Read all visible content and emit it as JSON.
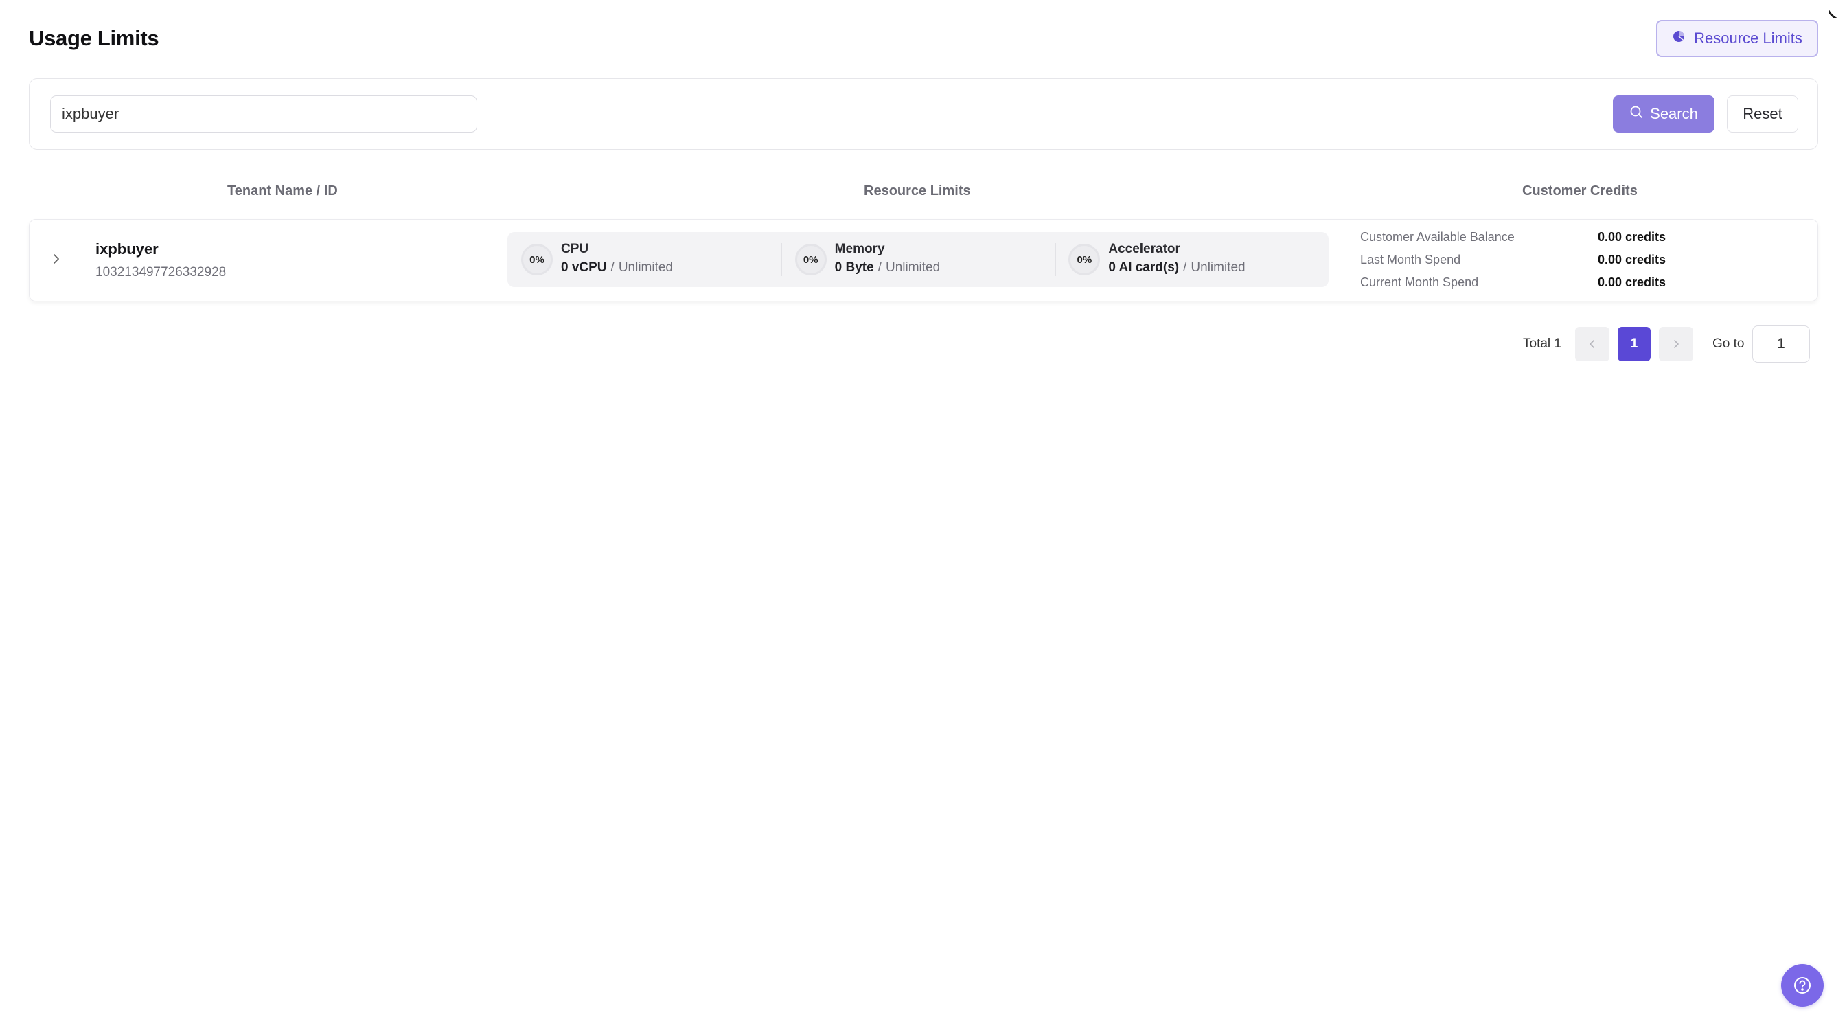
{
  "page": {
    "title": "Usage Limits"
  },
  "header": {
    "resource_limits_button": "Resource Limits",
    "resource_limits_icon": "pie-chart-icon"
  },
  "search": {
    "value": "ixpbuyer",
    "search_button": "Search",
    "reset_button": "Reset"
  },
  "table": {
    "columns": [
      "Tenant Name / ID",
      "Resource Limits",
      "Customer Credits"
    ],
    "rows": [
      {
        "tenant_name": "ixpbuyer",
        "tenant_id": "103213497726332928",
        "resources": [
          {
            "percent": "0%",
            "name": "CPU",
            "used": "0 vCPU",
            "separator": "/",
            "limit": "Unlimited"
          },
          {
            "percent": "0%",
            "name": "Memory",
            "used": "0 Byte",
            "separator": "/",
            "limit": "Unlimited"
          },
          {
            "percent": "0%",
            "name": "Accelerator",
            "used": "0 AI card(s)",
            "separator": "/",
            "limit": "Unlimited"
          }
        ],
        "credits": [
          {
            "label": "Customer Available Balance",
            "value": "0.00 credits"
          },
          {
            "label": "Last Month Spend",
            "value": "0.00 credits"
          },
          {
            "label": "Current Month Spend",
            "value": "0.00 credits"
          }
        ]
      }
    ]
  },
  "pagination": {
    "total": "Total 1",
    "current_page": "1",
    "goto_label": "Go to",
    "goto_value": "1"
  },
  "help": {
    "icon": "help-circle-icon"
  },
  "colors": {
    "accent": "#5a48d6",
    "search_button": "#8b7ddf",
    "help_button": "#7b68e8"
  }
}
